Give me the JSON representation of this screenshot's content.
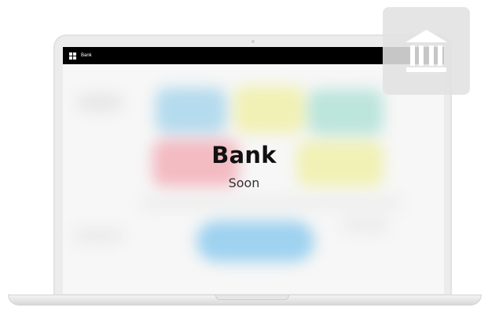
{
  "app": {
    "topbar_title": "Bank"
  },
  "overlay": {
    "title": "Bank",
    "subtitle": "Soon"
  },
  "icons": {
    "app_logo": "grid-logo-icon",
    "feature_icon": "bank-building-icon"
  },
  "colors": {
    "topbar": "#000000",
    "tile_background": "#e1e1e1",
    "icon": "#ffffff"
  }
}
